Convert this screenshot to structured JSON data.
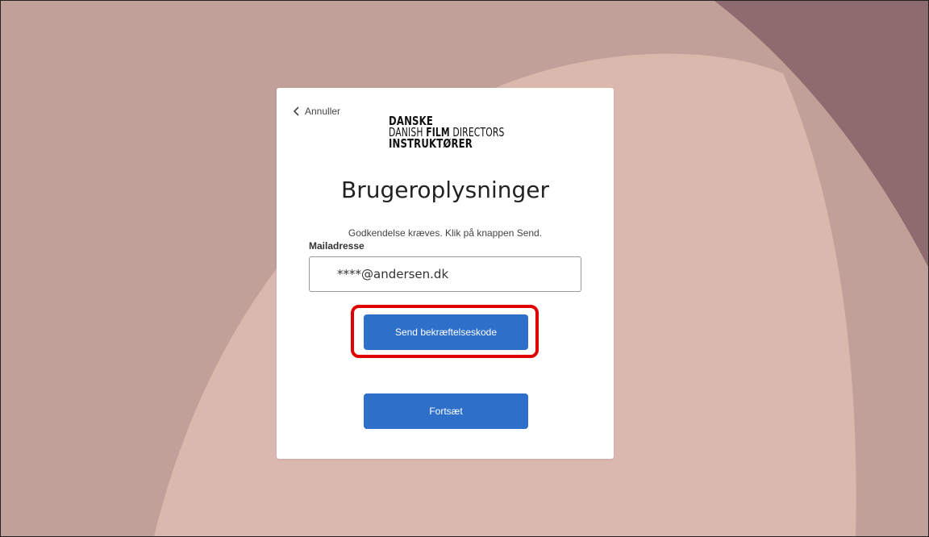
{
  "colors": {
    "background_base": "#c0a098",
    "background_light": "#dbb8ae",
    "background_corner": "#8f6a6e",
    "button_primary": "#2e6fc9",
    "highlight": "#e00000"
  },
  "card": {
    "cancel_label": "Annuller",
    "logo": {
      "line1": "DANSKE",
      "line2_regular_a": "DANISH ",
      "line2_bold": "FILM",
      "line2_regular_b": " DIRECTORS",
      "line3": "INSTRUKTØRER"
    },
    "title": "Brugeroplysninger",
    "intro": "Godkendelse kræves. Klik på knappen Send.",
    "email": {
      "label": "Mailadresse",
      "value": "****@andersen.dk"
    },
    "send_code_label": "Send bekræftelseskode",
    "continue_label": "Fortsæt"
  }
}
